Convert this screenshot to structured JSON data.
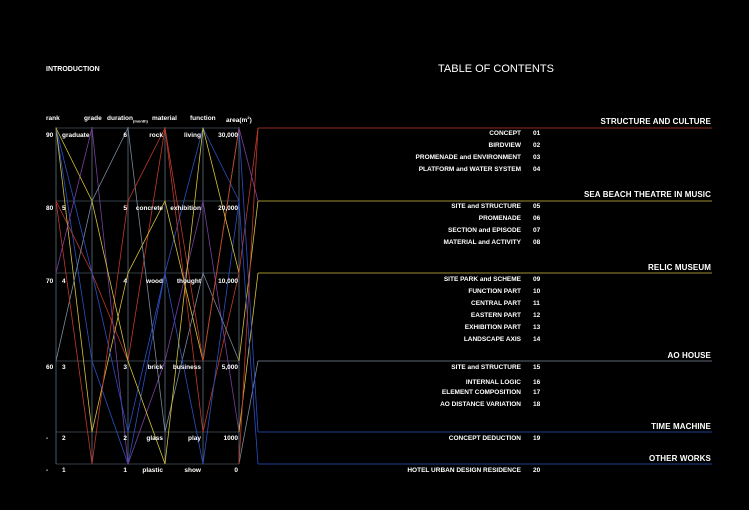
{
  "intro_label": "INTRODUCTION",
  "toc_title": "TABLE OF CONTENTS",
  "headers": {
    "rank": "rank",
    "grade": "grade",
    "duration": "duration",
    "duration_unit": "(month)",
    "material": "material",
    "function": "function",
    "area": "area(m",
    "area_sup": "2",
    "area_close": ")"
  },
  "rows": [
    {
      "rank": "90",
      "grade": "graduate",
      "duration": "6",
      "material": "rock",
      "function": "living",
      "area": "30,000"
    },
    {
      "rank": "80",
      "grade": "5",
      "duration": "5",
      "material": "concrete",
      "function": "exhibition",
      "area": "20,000"
    },
    {
      "rank": "70",
      "grade": "4",
      "duration": "4",
      "material": "wood",
      "function": "thought",
      "area": "10,000"
    },
    {
      "rank": "60",
      "grade": "3",
      "duration": "3",
      "material": "brick",
      "function": "business",
      "area": "5,000"
    },
    {
      "rank": "-",
      "grade": "2",
      "duration": "2",
      "material": "glass",
      "function": "play",
      "area": "1000"
    },
    {
      "rank": "-",
      "grade": "1",
      "duration": "1",
      "material": "plastic",
      "function": "show",
      "area": "0"
    }
  ],
  "sections": [
    {
      "title": "STRUCTURE AND CULTURE",
      "items": [
        {
          "label": "CONCEPT",
          "num": "01"
        },
        {
          "label": "BIRDVIEW",
          "num": "02"
        },
        {
          "label": "PROMENADE  and  ENVIRONMENT",
          "num": "03"
        },
        {
          "label": "PLATFORM  and  WATER SYSTEM",
          "num": "04"
        }
      ]
    },
    {
      "title": "SEA BEACH THEATRE IN MUSIC",
      "items": [
        {
          "label": "SITE  and  STRUCTURE",
          "num": "05"
        },
        {
          "label": "PROMENADE",
          "num": "06"
        },
        {
          "label": "SECTION  and  EPISODE",
          "num": "07"
        },
        {
          "label": "MATERIAL  and  ACTIVITY",
          "num": "08"
        }
      ]
    },
    {
      "title": "RELIC MUSEUM",
      "items": [
        {
          "label": "SITE PARK  and  SCHEME",
          "num": "09"
        },
        {
          "label": "FUNCTION PART",
          "num": "10"
        },
        {
          "label": "CENTRAL PART",
          "num": "11"
        },
        {
          "label": "EASTERN PART",
          "num": "12"
        },
        {
          "label": "EXHIBITION PART",
          "num": "13"
        },
        {
          "label": "LANDSCAPE AXIS",
          "num": "14"
        }
      ]
    },
    {
      "title": "AO HOUSE",
      "items": [
        {
          "label": "SITE  and  STRUCTURE",
          "num": "15"
        },
        {
          "label": "INTERNAL LOGIC",
          "num": "16"
        },
        {
          "label": "ELEMENT COMPOSITION",
          "num": "17"
        },
        {
          "label": "AO DISTANCE VARIATION",
          "num": "18"
        }
      ]
    },
    {
      "title": "TIME MACHINE",
      "items": [
        {
          "label": "CONCEPT DEDUCTION",
          "num": "19"
        }
      ]
    },
    {
      "title": "OTHER WORKS",
      "items": [
        {
          "label": "HOTEL   URBAN DESIGN   RESIDENCE",
          "num": "20"
        }
      ]
    }
  ],
  "colors": {
    "red": "#c0392b",
    "yellow": "#d4c23a",
    "blue": "#2a4fc4",
    "purple": "#7a3fa0",
    "grey": "#7a8a99"
  }
}
